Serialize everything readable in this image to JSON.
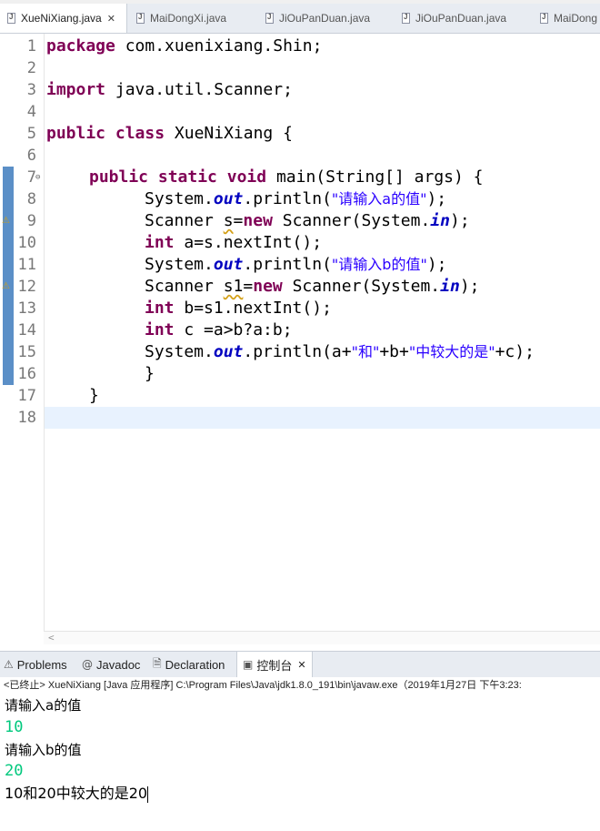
{
  "editor_tabs": [
    {
      "label": "XueNiXiang.java",
      "active": true
    },
    {
      "label": "MaiDongXi.java"
    },
    {
      "label": "JiOuPanDuan.java"
    },
    {
      "label": "JiOuPanDuan.java"
    },
    {
      "label": "MaiDong"
    }
  ],
  "close_glyph": "✕",
  "line_numbers": [
    "1",
    "2",
    "3",
    "4",
    "5",
    "6",
    "7",
    "8",
    "9",
    "10",
    "11",
    "12",
    "13",
    "14",
    "15",
    "16",
    "17",
    "18"
  ],
  "code": {
    "l1_kw": "package",
    "l1_rest": " com.xuenixiang.Shin;",
    "l3_kw": "import",
    "l3_rest": " java.util.Scanner;",
    "l5_kw1": "public",
    "l5_kw2": "class",
    "l5_rest": " XueNiXiang {",
    "l7_kw1": "public",
    "l7_kw2": "static",
    "l7_kw3": "void",
    "l7_rest": " main(String[] args) {",
    "l8_a": "System.",
    "l8_fld": "out",
    "l8_b": ".println(",
    "l8_str": "\"请输入a的值\"",
    "l8_c": ");",
    "l9_a": "Scanner ",
    "l9_var": "s",
    "l9_b": "=",
    "l9_kw": "new",
    "l9_c": " Scanner(System.",
    "l9_fld": "in",
    "l9_d": ");",
    "l10_kw": "int",
    "l10_rest": " a=s.nextInt();",
    "l11_a": "System.",
    "l11_fld": "out",
    "l11_b": ".println(",
    "l11_str": "\"请输入b的值\"",
    "l11_c": ");",
    "l12_a": "Scanner ",
    "l12_var": "s1",
    "l12_b": "=",
    "l12_kw": "new",
    "l12_c": " Scanner(System.",
    "l12_fld": "in",
    "l12_d": ");",
    "l13_kw": "int",
    "l13_rest": " b=s1.nextInt();",
    "l14_kw": "int",
    "l14_rest": " c =a>b?a:b;",
    "l15_a": "System.",
    "l15_fld": "out",
    "l15_b": ".println(a+",
    "l15_s1": "\"和\"",
    "l15_c": "+b+",
    "l15_s2": "\"中较大的是\"",
    "l15_d": "+c);",
    "l16": "}",
    "l17": "}"
  },
  "views_tabs": [
    {
      "label": "Problems",
      "icon": "problems-icon"
    },
    {
      "label": "Javadoc",
      "icon": "javadoc-icon"
    },
    {
      "label": "Declaration",
      "icon": "declaration-icon"
    },
    {
      "label": "控制台",
      "icon": "console-icon",
      "active": true
    }
  ],
  "console_header": "<已终止> XueNiXiang [Java 应用程序] C:\\Program Files\\Java\\jdk1.8.0_191\\bin\\javaw.exe（2019年1月27日 下午3:23:",
  "console_lines": {
    "prompt_a": "请输入a的值",
    "input_a": "10",
    "prompt_b": "请输入b的值",
    "input_b": "20",
    "result": "10和20中较大的是20"
  },
  "colors": {
    "keyword": "#7f0055",
    "string": "#2a00ff",
    "field": "#0000c0",
    "console_input": "#00c87d"
  }
}
